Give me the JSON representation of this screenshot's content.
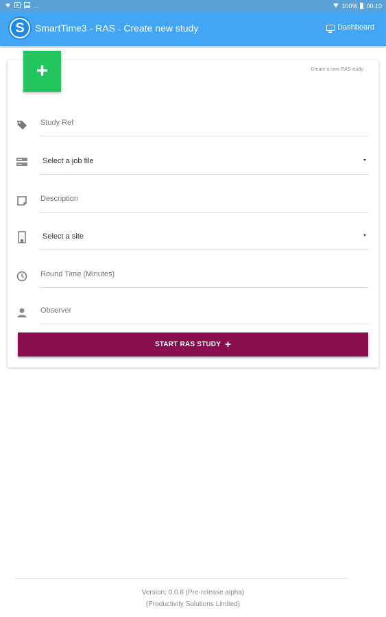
{
  "status_bar": {
    "left_icons": [
      "wifi-icon",
      "play-icon",
      "image-icon",
      "more-icon"
    ],
    "more_label": "...",
    "battery_percent": "100%",
    "time": "00:10"
  },
  "app_bar": {
    "logo_letter": "S",
    "title": "SmartTime3 - RAS - Create new study",
    "dashboard_label": "Dashboard"
  },
  "card": {
    "add_symbol": "+",
    "caption": "Create a new RAS study",
    "fields": {
      "study_ref": {
        "label": "Study Ref"
      },
      "job_file": {
        "label": "Select a job file"
      },
      "description": {
        "label": "Description"
      },
      "site": {
        "label": "Select a site"
      },
      "round_time": {
        "label": "Round Time (Minutes)"
      },
      "observer": {
        "label": "Observer"
      }
    },
    "start_button": {
      "label": "START RAS STUDY",
      "symbol": "+"
    }
  },
  "footer": {
    "version": "Version: 0.0.8 (Pre-release alpha)",
    "company": "(Productivity Solutions Limited)"
  },
  "colors": {
    "app_bar": "#42a5f5",
    "status_bar": "#5aa1d8",
    "add_tile": "#22c55e",
    "start_button": "#880e4f"
  }
}
